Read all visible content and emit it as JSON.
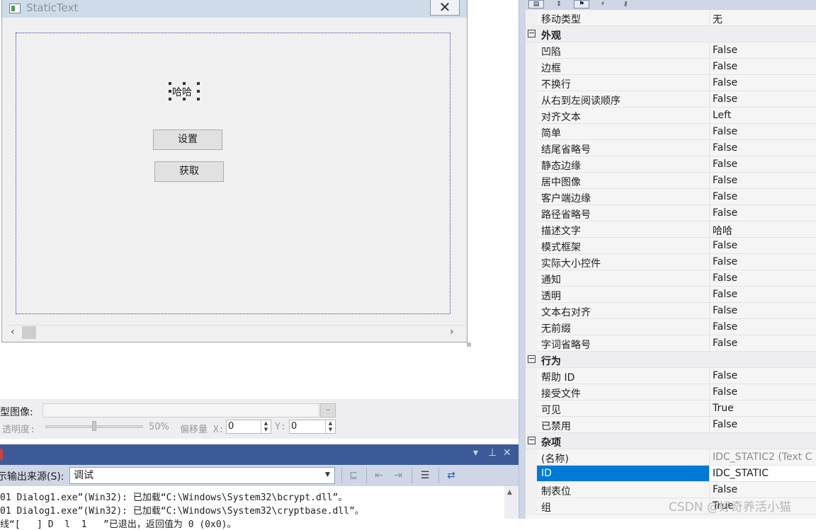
{
  "dialog": {
    "title": "StaticText",
    "static_text": "哈哈",
    "set_button": "设置",
    "get_button": "获取"
  },
  "image_bar": {
    "image_label": "源型图像:",
    "browse_label": "..",
    "opacity_label": "透明度:",
    "opacity_value": "50%",
    "offset_x_label": "偏移量 X:",
    "offset_x_value": "0",
    "offset_y_label": "Y:",
    "offset_y_value": "0"
  },
  "output": {
    "source_label": "示输出来源(S):",
    "source_value": "调试",
    "lines": [
      "01 Dialog1.exe”(Win32): 已加载“C:\\Windows\\System32\\bcrypt.dll”。",
      "01 Dialog1.exe”(Win32): 已加载“C:\\Windows\\System32\\cryptbase.dll”。",
      "线“[   ] D  l  1   ”已退出，返回值为 0 (0x0)。"
    ]
  },
  "properties": {
    "rows": [
      {
        "kind": "prop",
        "name": "移动类型",
        "value": "无"
      },
      {
        "kind": "cat",
        "name": "外观"
      },
      {
        "kind": "prop",
        "name": "凹陷",
        "value": "False"
      },
      {
        "kind": "prop",
        "name": "边框",
        "value": "False"
      },
      {
        "kind": "prop",
        "name": "不换行",
        "value": "False"
      },
      {
        "kind": "prop",
        "name": "从右到左阅读顺序",
        "value": "False"
      },
      {
        "kind": "prop",
        "name": "对齐文本",
        "value": "Left"
      },
      {
        "kind": "prop",
        "name": "简单",
        "value": "False"
      },
      {
        "kind": "prop",
        "name": "结尾省略号",
        "value": "False"
      },
      {
        "kind": "prop",
        "name": "静态边缘",
        "value": "False"
      },
      {
        "kind": "prop",
        "name": "居中图像",
        "value": "False"
      },
      {
        "kind": "prop",
        "name": "客户端边缘",
        "value": "False"
      },
      {
        "kind": "prop",
        "name": "路径省略号",
        "value": "False"
      },
      {
        "kind": "prop",
        "name": "描述文字",
        "value": "哈哈"
      },
      {
        "kind": "prop",
        "name": "模式框架",
        "value": "False"
      },
      {
        "kind": "prop",
        "name": "实际大小控件",
        "value": "False"
      },
      {
        "kind": "prop",
        "name": "通知",
        "value": "False"
      },
      {
        "kind": "prop",
        "name": "透明",
        "value": "False"
      },
      {
        "kind": "prop",
        "name": "文本右对齐",
        "value": "False"
      },
      {
        "kind": "prop",
        "name": "无前缀",
        "value": "False"
      },
      {
        "kind": "prop",
        "name": "字词省略号",
        "value": "False"
      },
      {
        "kind": "cat",
        "name": "行为"
      },
      {
        "kind": "prop",
        "name": "帮助 ID",
        "value": "False"
      },
      {
        "kind": "prop",
        "name": "接受文件",
        "value": "False"
      },
      {
        "kind": "prop",
        "name": "可见",
        "value": "True"
      },
      {
        "kind": "prop",
        "name": "已禁用",
        "value": "False"
      },
      {
        "kind": "cat",
        "name": "杂项"
      },
      {
        "kind": "prop",
        "name": "(名称)",
        "value": "IDC_STATIC2 (Text C",
        "grey": true
      },
      {
        "kind": "prop",
        "name": "ID",
        "value": "IDC_STATIC",
        "selected": true
      },
      {
        "kind": "prop",
        "name": "制表位",
        "value": "False"
      },
      {
        "kind": "prop",
        "name": "组",
        "value": "True"
      }
    ]
  },
  "watermark": "CSDN @好奇养活小猫"
}
